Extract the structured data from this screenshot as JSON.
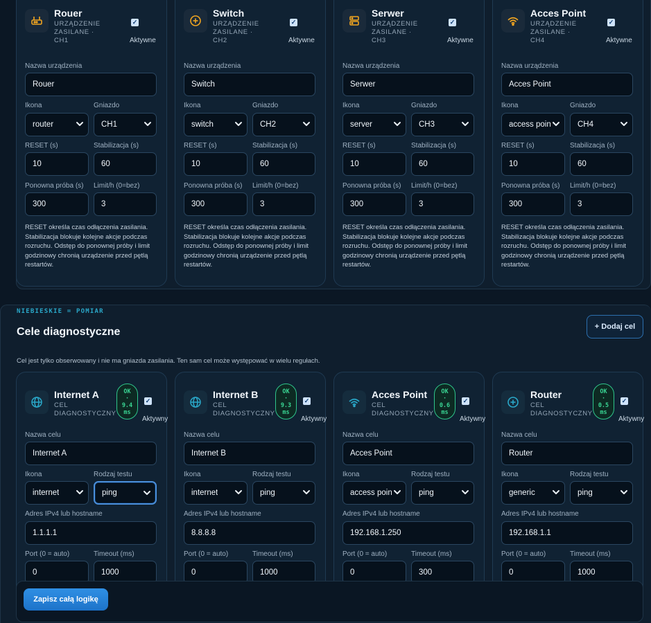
{
  "power_devices": [
    {
      "name": "Rouer",
      "subtitle": "URZĄDZENIE ZASILANE · CH1",
      "icon": "router",
      "socket": "CH1",
      "reset": "10",
      "stab": "60",
      "retry": "300",
      "limit": "3",
      "icon_name": "router-icon"
    },
    {
      "name": "Switch",
      "subtitle": "URZĄDZENIE ZASILANE · CH2",
      "icon": "switch",
      "socket": "CH2",
      "reset": "10",
      "stab": "60",
      "retry": "300",
      "limit": "3",
      "icon_name": "switch-icon"
    },
    {
      "name": "Serwer",
      "subtitle": "URZĄDZENIE ZASILANE · CH3",
      "icon": "server",
      "socket": "CH3",
      "reset": "10",
      "stab": "60",
      "retry": "300",
      "limit": "3",
      "icon_name": "server-icon"
    },
    {
      "name": "Acces Point",
      "subtitle": "URZĄDZENIE ZASILANE · CH4",
      "icon": "access point",
      "socket": "CH4",
      "reset": "10",
      "stab": "60",
      "retry": "300",
      "limit": "3",
      "icon_name": "wifi-icon"
    }
  ],
  "device_labels": {
    "active": "Aktywne",
    "name": "Nazwa urządzenia",
    "icon": "Ikona",
    "socket": "Gniazdo",
    "reset": "RESET (s)",
    "stab": "Stabilizacja (s)",
    "retry": "Ponowna próba (s)",
    "limit": "Limit/h (0=bez)",
    "note": "RESET określa czas odłączenia zasilania. Stabilizacja blokuje kolejne akcje podczas rozruchu. Odstęp do ponownej próby i limit godzinowy chronią urządzenie przed pętlą restartów."
  },
  "diagnostics": {
    "tag": "NIEBIESKIE = POMIAR",
    "title": "Cele diagnostyczne",
    "add_button": "+ Dodaj cel",
    "description": "Cel jest tylko obserwowany i nie ma gniazda zasilania. Ten sam cel może występować w wielu regułach.",
    "targets": [
      {
        "name": "Internet A",
        "subtitle": "CEL DIAGNOSTYCZNY",
        "status": "OK",
        "latency": "9.4",
        "unit": "ms",
        "icon": "internet",
        "test": "ping",
        "host": "1.1.1.1",
        "port": "0",
        "timeout": "1000",
        "icon_name": "globe-icon"
      },
      {
        "name": "Internet B",
        "subtitle": "CEL DIAGNOSTYCZNY",
        "status": "OK",
        "latency": "9.3",
        "unit": "ms",
        "icon": "internet",
        "test": "ping",
        "host": "8.8.8.8",
        "port": "0",
        "timeout": "1000",
        "icon_name": "globe-icon"
      },
      {
        "name": "Acces Point",
        "subtitle": "CEL DIAGNOSTYCZNY",
        "status": "OK",
        "latency": "0.6",
        "unit": "ms",
        "icon": "access point",
        "test": "ping",
        "host": "192.168.1.250",
        "port": "0",
        "timeout": "300",
        "icon_name": "wifi-icon"
      },
      {
        "name": "Router",
        "subtitle": "CEL DIAGNOSTYCZNY",
        "status": "OK",
        "latency": "0.5",
        "unit": "ms",
        "icon": "generic",
        "test": "ping",
        "host": "192.168.1.1",
        "port": "0",
        "timeout": "1000",
        "icon_name": "plus-circle-icon"
      }
    ],
    "labels": {
      "active": "Aktywny",
      "name": "Nazwa celu",
      "icon": "Ikona",
      "test": "Rodzaj testu",
      "host": "Adres IPv4 lub hostname",
      "port": "Port (0 = auto)",
      "timeout": "Timeout (ms)"
    }
  },
  "footer": {
    "save_button": "Zapisz całą logikę"
  },
  "colors": {
    "accent": "#2f8fe4",
    "ok": "#39d493",
    "device_icon": "#f0a420",
    "diag_icon": "#2aa8c9"
  }
}
